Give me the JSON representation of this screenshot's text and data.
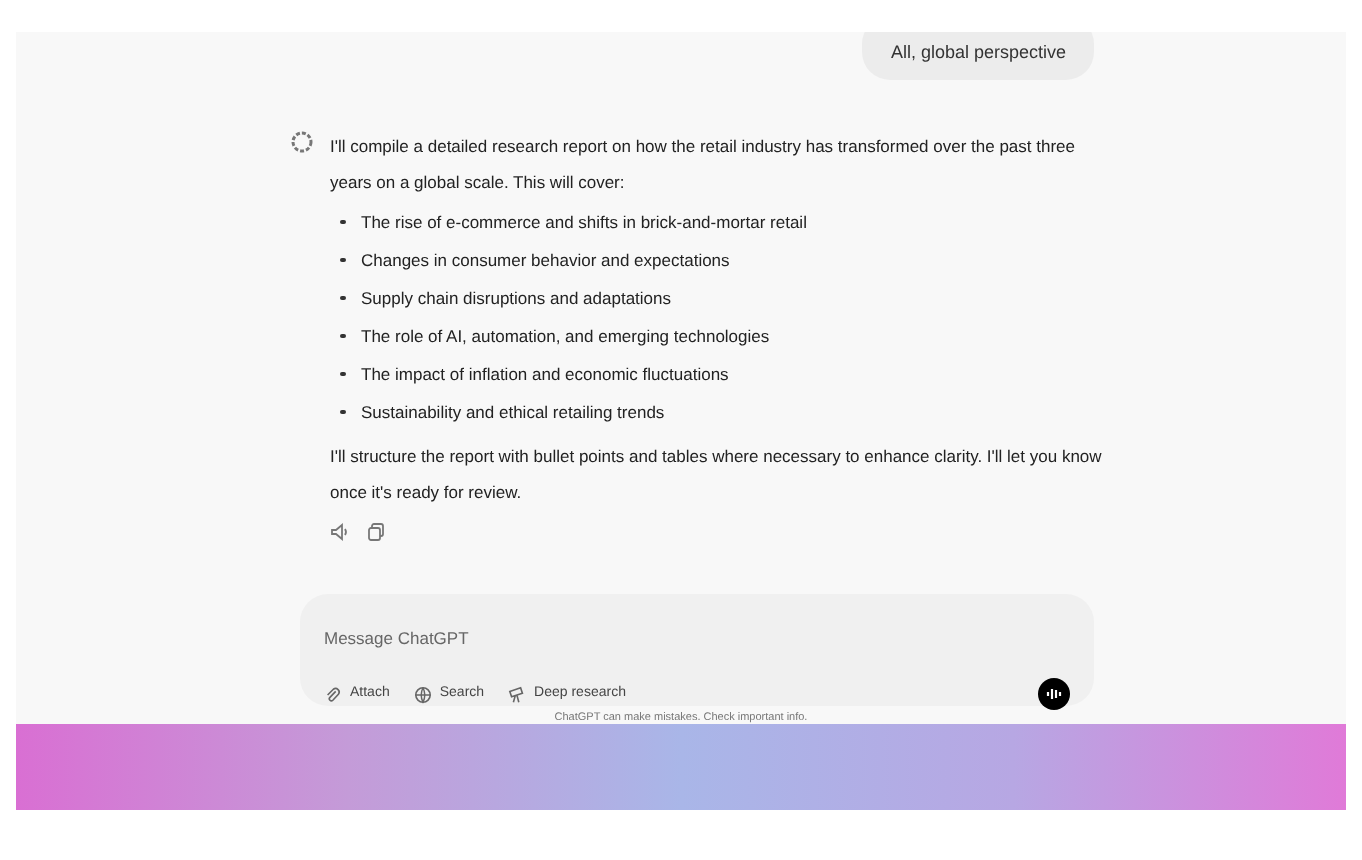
{
  "user_message": {
    "text": "All, global perspective"
  },
  "assistant_message": {
    "intro": "I'll compile a detailed research report on how the retail industry has transformed over the past three years on a global scale. This will cover:",
    "bullets": [
      "The rise of e-commerce and shifts in brick-and-mortar retail",
      "Changes in consumer behavior and expectations",
      "Supply chain disruptions and adaptations",
      "The role of AI, automation, and emerging technologies",
      "The impact of inflation and economic fluctuations",
      "Sustainability and ethical retailing trends"
    ],
    "outro": "I'll structure the report with bullet points and tables where necessary to enhance clarity. I'll let you know once it's ready for review."
  },
  "composer": {
    "placeholder": "Message ChatGPT",
    "tools": [
      {
        "kind": "attach",
        "label": "Attach"
      },
      {
        "kind": "search",
        "label": "Search"
      },
      {
        "kind": "research",
        "label": "Deep research"
      }
    ]
  },
  "disclaimer": "ChatGPT can make mistakes. Check important info."
}
